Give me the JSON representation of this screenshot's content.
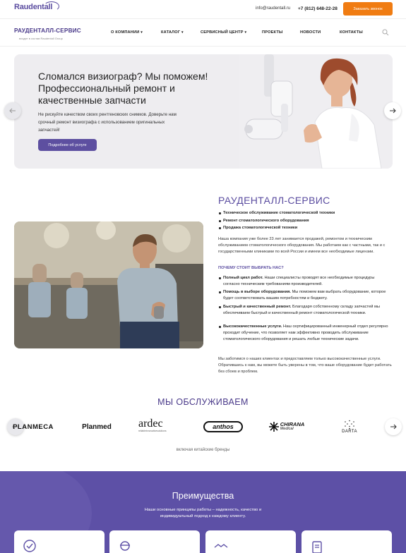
{
  "topbar": {
    "logo": "Raudentall",
    "email": "info@raudentall.ru",
    "phone": "+7 (812) 648-22-28",
    "call_button": "Заказать звонок"
  },
  "nav": {
    "brand": "РАУДЕНТАЛЛ-СЕРВИС",
    "brand_sub": "входит в состав Raudentall Group",
    "items": [
      {
        "label": "О КОМПАНИИ",
        "dropdown": "▾"
      },
      {
        "label": "КАТАЛОГ",
        "dropdown": "▾"
      },
      {
        "label": "СЕРВИСНЫЙ ЦЕНТР",
        "dropdown": "▾"
      },
      {
        "label": "ПРОЕКТЫ"
      },
      {
        "label": "НОВОСТИ"
      },
      {
        "label": "КОНТАКТЫ"
      }
    ],
    "search_icon": "search-icon"
  },
  "hero": {
    "title": "Сломался визиограф? Мы поможем! Профессиональный ремонт и качественные запчасти",
    "text": "Не рискуйте качеством своих рентгеновских снимков. Доверьте нам срочный ремонт визиографа с использованием оригинальных запчастей!",
    "button": "Подробнее об услуге"
  },
  "about": {
    "title": "РАУДЕНТАЛЛ-СЕРВИС",
    "services": [
      "Техническое обслуживание стоматологической техники",
      "Ремонт стоматологического оборудования",
      "Продажа стоматологической техники"
    ],
    "intro": "Наша компания уже более 23 лет занимается продажей, ремонтом и техническим обслуживанием стоматологического оборудования. Мы работаем как с частными, так и с государственными клиниками по всей России и имеем все необходимые лицензии.",
    "why_title": "ПОЧЕМУ СТОИТ ВЫБРАТЬ НАС?",
    "reasons": [
      {
        "bold": "Полный цикл работ.",
        "text": " Наши специалисты проводят все необходимые процедуры согласно техническим требованиям производителей."
      },
      {
        "bold": "Помощь в выборе оборудования.",
        "text": " Мы поможем вам выбрать оборудование, которое будет соответствовать вашим потребностям и бюджету."
      },
      {
        "bold": "Быстрый и качественный ремонт.",
        "text": " Благодаря собственному складу запчастей мы обеспечиваем быстрый и качественный ремонт стоматологической техники."
      },
      {
        "bold": "Высококачественные услуги.",
        "text": " Наш сертифицированный инженерный отдел регулярно проходит обучение, что позволяет нам эффективно проводить обслуживание стоматологического оборудования и решать любые технические задачи."
      }
    ],
    "outro": "Мы заботимся о наших клиентах и предоставляем только высококачественные услуги. Обратившись к нам, вы можете быть уверены в том, что ваше оборудование будет работать без сбоев и проблем."
  },
  "serve": {
    "title": "МЫ ОБСЛУЖИВАЕМ",
    "brands": [
      "PLANMECA",
      "Planmed",
      "ardec",
      "anthos",
      "CHIRANA",
      "DARTA"
    ],
    "ardec_tag": "reliableinnovativesolutions",
    "chirana_sub": "Medical",
    "note": "включая китайские бренды"
  },
  "advantages": {
    "title": "Преимущества",
    "text": "Наши основные принципы работы – надежность, качество и индивидуальный подход к каждому клиенту."
  },
  "colors": {
    "accent": "#5d4fa0",
    "orange": "#f07c12"
  }
}
